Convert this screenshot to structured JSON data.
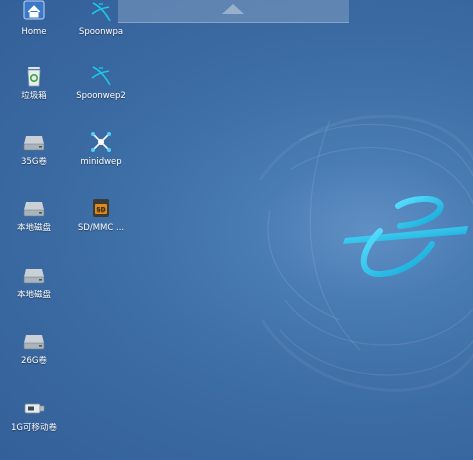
{
  "desktop": {
    "icons": [
      {
        "label": "Home",
        "icon": "home-folder-icon"
      },
      {
        "label": "Spoonwpa",
        "icon": "spoon-app-icon"
      },
      {
        "label": "垃圾箱",
        "icon": "trash-icon"
      },
      {
        "label": "Spoonwep2",
        "icon": "spoon-app-icon"
      },
      {
        "label": "35G卷",
        "icon": "drive-icon"
      },
      {
        "label": "minidwep",
        "icon": "minidwep-app-icon"
      },
      {
        "label": "本地磁盘",
        "icon": "drive-icon"
      },
      {
        "label": "SD/MMC ...",
        "icon": "sd-card-icon"
      },
      {
        "label": "本地磁盘",
        "icon": "drive-icon"
      },
      {
        "label": "26G卷",
        "icon": "drive-icon"
      },
      {
        "label": "1G可移动卷",
        "icon": "usb-drive-icon"
      }
    ]
  },
  "colors": {
    "background": "#3f70a8",
    "logo_accent": "#1cc4e8"
  }
}
